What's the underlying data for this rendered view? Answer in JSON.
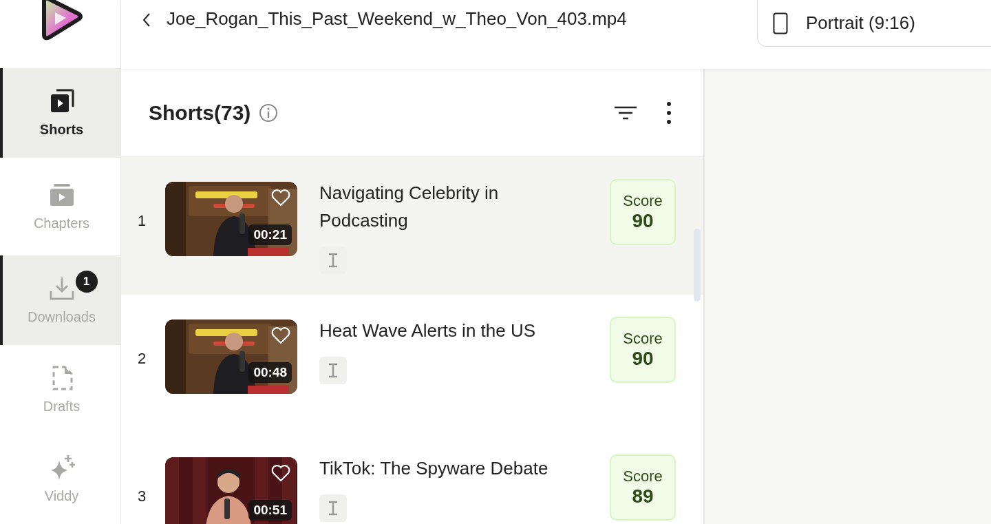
{
  "header": {
    "file_name": "Joe_Rogan_This_Past_Weekend_w_Theo_Von_403.mp4",
    "aspect": "Portrait (9:16)"
  },
  "sidebar": {
    "items": [
      {
        "kind": "shorts",
        "label": "Shorts",
        "selected": true,
        "hovered": false
      },
      {
        "kind": "chapters",
        "label": "Chapters",
        "selected": false,
        "hovered": false
      },
      {
        "kind": "downloads",
        "label": "Downloads",
        "selected": false,
        "hovered": true,
        "badge": "1"
      },
      {
        "kind": "drafts",
        "label": "Drafts",
        "selected": false,
        "hovered": false
      },
      {
        "kind": "viddy",
        "label": "Viddy",
        "selected": false,
        "hovered": false
      }
    ]
  },
  "shorts": {
    "title": "Shorts(73)",
    "items": [
      {
        "index": "1",
        "title": "Navigating Celebrity in Podcasting",
        "duration": "00:21",
        "score_label": "Score",
        "score": "90",
        "selected": true
      },
      {
        "index": "2",
        "title": "Heat Wave Alerts in the US",
        "duration": "00:48",
        "score_label": "Score",
        "score": "90",
        "selected": false
      },
      {
        "index": "3",
        "title": "TikTok: The Spyware Debate",
        "duration": "00:51",
        "score_label": "Score",
        "score": "89",
        "selected": false
      }
    ]
  }
}
